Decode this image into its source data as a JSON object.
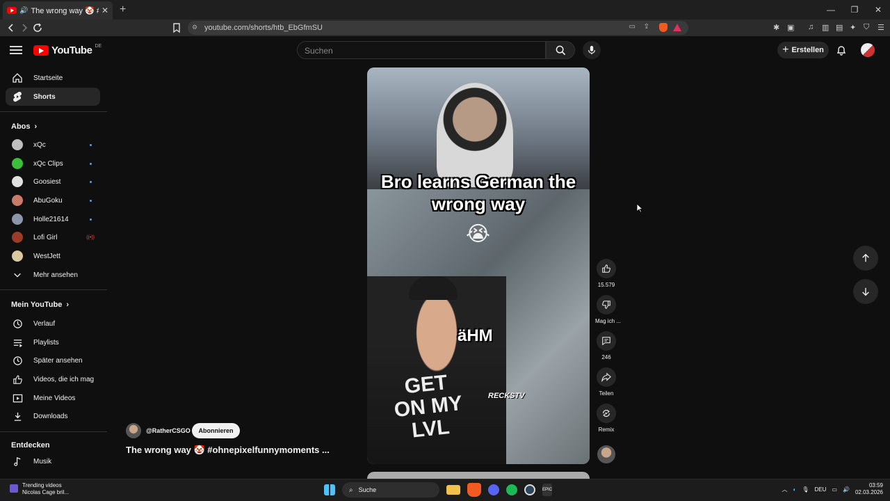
{
  "browser": {
    "tab_title": "The wrong way 🤡 #ohnepi",
    "url": "youtube.com/shorts/htb_EbGfmSU"
  },
  "header": {
    "logo_text": "YouTube",
    "country_code": "DE",
    "search_placeholder": "Suchen",
    "create_label": "Erstellen"
  },
  "sidebar": {
    "main": [
      {
        "label": "Startseite",
        "icon": "home-icon"
      },
      {
        "label": "Shorts",
        "icon": "shorts-icon"
      }
    ],
    "subs_heading": "Abos",
    "subs": [
      {
        "label": "xQc",
        "color": "#bfbfbf",
        "indicator": "dot"
      },
      {
        "label": "xQc Clips",
        "color": "#3cbf3c",
        "indicator": "dot"
      },
      {
        "label": "Goosiest",
        "color": "#e0e0e0",
        "indicator": "dot"
      },
      {
        "label": "AbuGoku",
        "color": "#c87b6a",
        "indicator": "dot"
      },
      {
        "label": "Holle21614",
        "color": "#8d96a8",
        "indicator": "dot"
      },
      {
        "label": "Lofi Girl",
        "color": "#9b3b2a",
        "indicator": "live"
      },
      {
        "label": "WestJett",
        "color": "#d8c9a0",
        "indicator": "none"
      }
    ],
    "more_label": "Mehr ansehen",
    "you_heading": "Mein YouTube",
    "you": [
      {
        "label": "Verlauf",
        "icon": "history-icon"
      },
      {
        "label": "Playlists",
        "icon": "playlists-icon"
      },
      {
        "label": "Später ansehen",
        "icon": "watch-later-icon"
      },
      {
        "label": "Videos, die ich mag",
        "icon": "thumbs-up-icon"
      },
      {
        "label": "Meine Videos",
        "icon": "my-videos-icon"
      },
      {
        "label": "Downloads",
        "icon": "download-icon"
      }
    ],
    "explore_heading": "Entdecken",
    "explore": [
      {
        "label": "Musik",
        "icon": "music-icon"
      }
    ]
  },
  "video": {
    "caption": "Bro learns German the wrong way",
    "emoji": "😭",
    "overlay_word": "äHM",
    "shirt_text": "GET ON MY LVL",
    "watermark": "RECKSTV",
    "channel": "@RatherCSGO",
    "subscribe_label": "Abonnieren",
    "title": "The wrong way 🤡 #ohnepixelfunnymoments ..."
  },
  "actions": {
    "likes": "15.579",
    "dislike_label": "Mag ich ...",
    "comments": "246",
    "share_label": "Teilen",
    "remix_label": "Remix"
  },
  "taskbar": {
    "trend_title": "Trending videos",
    "trend_sub": "Nicolas Cage bril...",
    "search_label": "Suche",
    "lang": "DEU",
    "time": "03:59",
    "date": "02.03.2026"
  }
}
